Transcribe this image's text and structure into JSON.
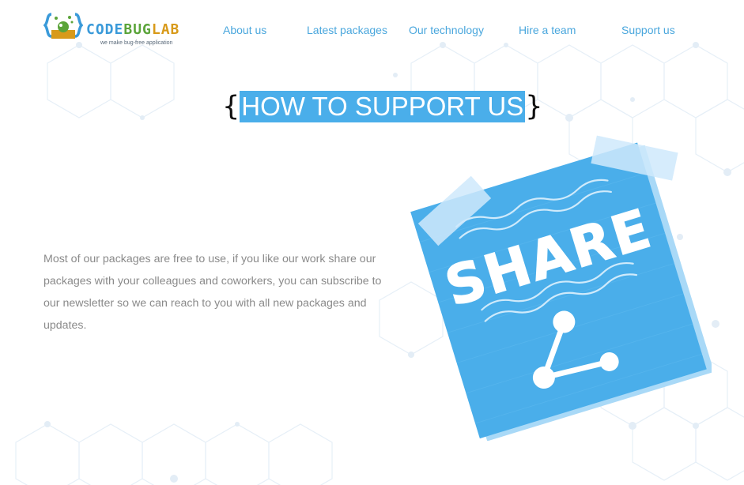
{
  "brand": {
    "logo_text_part1": "CODE",
    "logo_text_part2": "BUG",
    "logo_text_part3": "LAB",
    "tagline": "we make bug-free application",
    "colors": {
      "blue": "#3a9ad9",
      "green": "#5ba43a",
      "orange": "#d89a1a"
    }
  },
  "nav": {
    "items": [
      {
        "label": "About us"
      },
      {
        "label": "Latest packages"
      },
      {
        "label": "Our technology"
      },
      {
        "label": "Hire a team"
      },
      {
        "label": "Support us"
      }
    ]
  },
  "hero": {
    "title": "HOW TO SUPPORT US",
    "brace_open": "{",
    "brace_close": "}"
  },
  "content": {
    "paragraph": "Most of our packages are free to use, if you like our work share our packages with your colleagues and coworkers, you can subscribe to our newsletter so we can reach to you with all new packages and updates."
  },
  "illustration": {
    "note_text": "SHARE",
    "icon": "share-icon",
    "accent": "#4aaeea"
  }
}
